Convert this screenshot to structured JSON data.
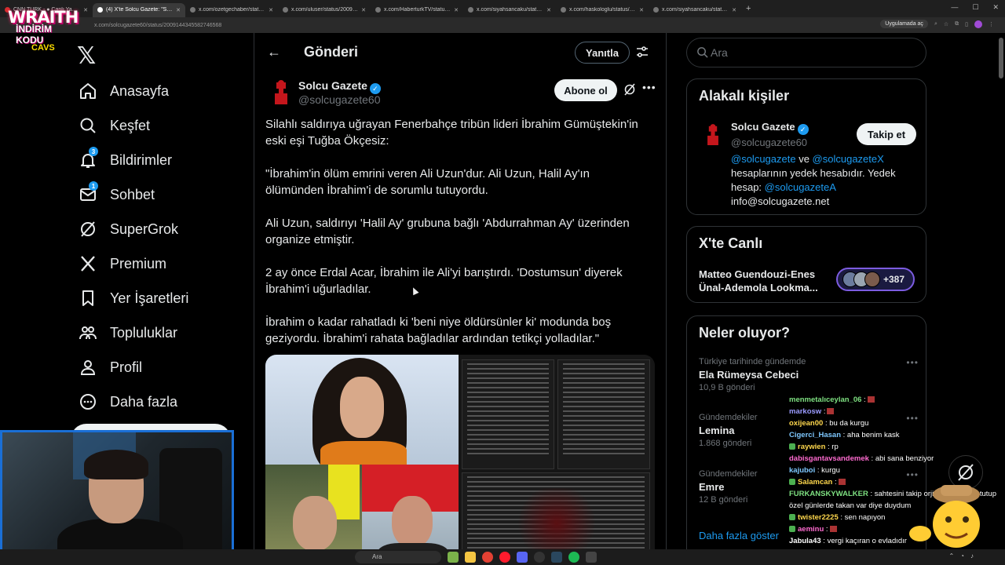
{
  "browser": {
    "tabs": [
      {
        "label": "CNN TÜRK - ● Canlı Yayın ᴴᴰ",
        "active": false
      },
      {
        "label": "(4) X'te Solcu Gazete: \"Silahlı sa...",
        "active": true
      },
      {
        "label": "x.com/ozetgechaber/status/20...",
        "active": false
      },
      {
        "label": "x.com/uluser/status/20090452...",
        "active": false
      },
      {
        "label": "x.com/HaberturkTV/status/200...",
        "active": false
      },
      {
        "label": "x.com/siyahsancaku/status/200...",
        "active": false
      },
      {
        "label": "x.com/haskologlu/status/2009...",
        "active": false
      },
      {
        "label": "x.com/siyahsancaku/status/20...",
        "active": false
      }
    ],
    "new_tab": "+",
    "url": "x.com/solcugazete60/status/2009144345582746568",
    "app_chip": "Uygulamada aç"
  },
  "stream_logo": {
    "line1": "WRAITH",
    "line2": "İNDİRİM KODU",
    "line3": "CAVS"
  },
  "nav": {
    "items": [
      {
        "label": "Anasayfa",
        "icon": "home-icon",
        "badge": ""
      },
      {
        "label": "Keşfet",
        "icon": "search-icon",
        "badge": ""
      },
      {
        "label": "Bildirimler",
        "icon": "bell-icon",
        "badge": "3"
      },
      {
        "label": "Sohbet",
        "icon": "mail-icon",
        "badge": "1"
      },
      {
        "label": "SuperGrok",
        "icon": "grok-icon",
        "badge": ""
      },
      {
        "label": "Premium",
        "icon": "x-icon",
        "badge": ""
      },
      {
        "label": "Yer İşaretleri",
        "icon": "bookmark-icon",
        "badge": ""
      },
      {
        "label": "Topluluklar",
        "icon": "communities-icon",
        "badge": ""
      },
      {
        "label": "Profil",
        "icon": "person-icon",
        "badge": ""
      },
      {
        "label": "Daha fazla",
        "icon": "more-circle-icon",
        "badge": ""
      }
    ]
  },
  "header": {
    "title": "Gönderi",
    "reply_label": "Yanıtla"
  },
  "post": {
    "author_name": "Solcu Gazete",
    "author_handle": "@solcugazete60",
    "subscribe_label": "Abone ol",
    "paragraphs": [
      "Silahlı saldırıya uğrayan Fenerbahçe tribün lideri İbrahim Gümüştekin'in eski eşi Tuğba Ökçesiz:",
      "\"İbrahim'in ölüm emrini veren Ali Uzun'dur. Ali Uzun, Halil Ay'ın ölümünden İbrahim'i de sorumlu tutuyordu.",
      "Ali Uzun, saldırıyı 'Halil Ay' grubuna bağlı 'Abdurrahman Ay' üzerinden organize etmiştir.",
      "2 ay önce Erdal Acar, İbrahim ile Ali'yi barıştırdı. 'Dostumsun' diyerek İbrahim'i uğurladılar.",
      "İbrahim o kadar rahatladı ki 'beni niye öldürsünler ki' modunda boş geziyordu. İbrahim'i rahata bağladılar ardından tetikçi yolladılar.\""
    ]
  },
  "search": {
    "placeholder": "Ara"
  },
  "related": {
    "title": "Alakalı kişiler",
    "name": "Solcu Gazete",
    "handle": "@solcugazete60",
    "follow_label": "Takip et",
    "bio_link1": "@solcugazete",
    "bio_and": " ve ",
    "bio_link2": "@solcugazeteX",
    "bio_mid": " hesaplarının yedek hesabıdır. Yedek hesap: ",
    "bio_link3": "@solcugazeteA",
    "bio_email": "info@solcugazete.net"
  },
  "live": {
    "title": "X'te Canlı",
    "name": "Matteo Guendouzi-Enes Ünal-Ademola Lookma...",
    "count": "+387"
  },
  "trends": {
    "title": "Neler oluyor?",
    "items": [
      {
        "category": "Türkiye tarihinde gündemde",
        "name": "Ela Rümeysa Cebeci",
        "count": "10,9 B gönderi"
      },
      {
        "category": "Gündemdekiler",
        "name": "Lemina",
        "count": "1.868 gönderi"
      },
      {
        "category": "Gündemdekiler",
        "name": "Emre",
        "count": "12 B gönderi"
      }
    ],
    "show_more": "Daha fazla göster"
  },
  "chat": [
    {
      "user": "menmetalıceylan_06",
      "msg": ":",
      "color": "#7ee081",
      "badge": false,
      "emote": true
    },
    {
      "user": "markosw",
      "msg": ":",
      "color": "#9b9bff",
      "badge": false,
      "emote": true
    },
    {
      "user": "oxijean00",
      "msg": ": bu da kurgu",
      "color": "#ffd84d",
      "badge": false,
      "emote": false
    },
    {
      "user": "Cigerci_Hasan",
      "msg": ": aha benim kask",
      "color": "#7ec8ff",
      "badge": false,
      "emote": false
    },
    {
      "user": "raywien",
      "msg": ": rp",
      "color": "#ffd84d",
      "badge": true,
      "emote": false
    },
    {
      "user": "dabisgantavsandemek",
      "msg": ": abi sana benziyor",
      "color": "#ff6bd0",
      "badge": false,
      "emote": false
    },
    {
      "user": "kajuboi",
      "msg": ": kurgu",
      "color": "#7ec8ff",
      "badge": false,
      "emote": false
    },
    {
      "user": "Salamcan",
      "msg": ":",
      "color": "#ffd84d",
      "badge": true,
      "emote": true
    },
    {
      "user": "FURKANSKYWALKER",
      "msg": ": sahtesini takip orjinalini hasada tutup",
      "color": "#7ee081",
      "badge": false,
      "emote": false
    },
    {
      "user": "",
      "msg": "özel günlerde takan var diye duydum",
      "color": "#ffffff",
      "badge": false,
      "emote": false
    },
    {
      "user": "twister2225",
      "msg": ": sen napıyon",
      "color": "#ffd84d",
      "badge": true,
      "emote": false
    },
    {
      "user": "aeminu",
      "msg": ":",
      "color": "#ff6bd0",
      "badge": true,
      "emote": true
    },
    {
      "user": "Jabula43",
      "msg": ": vergi kaçıran o evladıdır",
      "color": "#ffffff",
      "badge": false,
      "emote": false
    }
  ],
  "taskbar": {
    "search_label": "Ara"
  },
  "colors": {
    "accent": "#1d9bf0",
    "background": "#000000",
    "border": "#2f3336",
    "muted": "#71767b",
    "text": "#e7e9ea"
  }
}
